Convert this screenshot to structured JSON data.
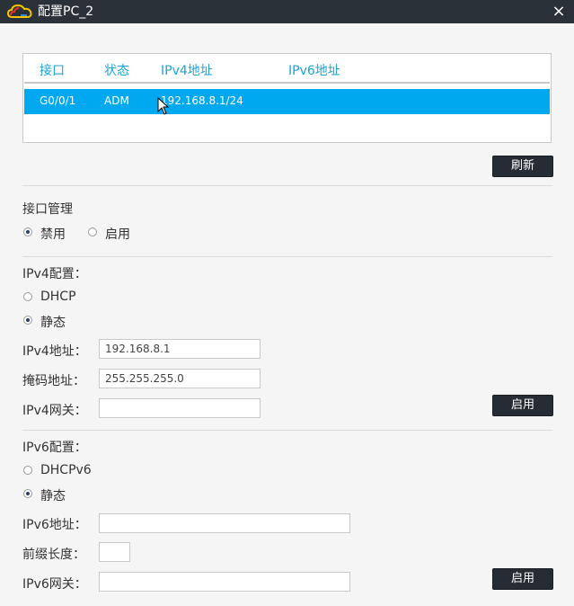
{
  "window": {
    "title": "配置PC_2",
    "close_icon": "×"
  },
  "interface_table": {
    "headers": {
      "interface": "接口",
      "status": "状态",
      "ipv4": "IPv4地址",
      "ipv6": "IPv6地址"
    },
    "rows": [
      {
        "interface": "G0/0/1",
        "status": "ADM",
        "ipv4": "192.168.8.1/24",
        "ipv6": ""
      }
    ]
  },
  "refresh_button": "刷新",
  "interface_mgmt": {
    "label": "接口管理",
    "options": [
      {
        "label": "禁用",
        "checked": true
      },
      {
        "label": "启用",
        "checked": false
      }
    ]
  },
  "ipv4": {
    "section_label": "IPv4配置：",
    "dhcp_label": "DHCP",
    "static_label": "静态",
    "mode": "static",
    "address_label": "IPv4地址：",
    "address_value": "192.168.8.1",
    "mask_label": "掩码地址：",
    "mask_value": "255.255.255.0",
    "gateway_label": "IPv4网关：",
    "gateway_value": "",
    "apply_button": "启用"
  },
  "ipv6": {
    "section_label": "IPv6配置：",
    "dhcp_label": "DHCPv6",
    "static_label": "静态",
    "mode": "static",
    "address_label": "IPv6地址：",
    "address_value": "",
    "prefix_label": "前缀长度：",
    "prefix_value": "",
    "gateway_label": "IPv6网关：",
    "gateway_value": "",
    "apply_button": "启用"
  },
  "colors": {
    "titlebar": "#2a3138",
    "accent": "#00a8f0",
    "header_text": "#1aa3d6",
    "button": "#252c33"
  }
}
